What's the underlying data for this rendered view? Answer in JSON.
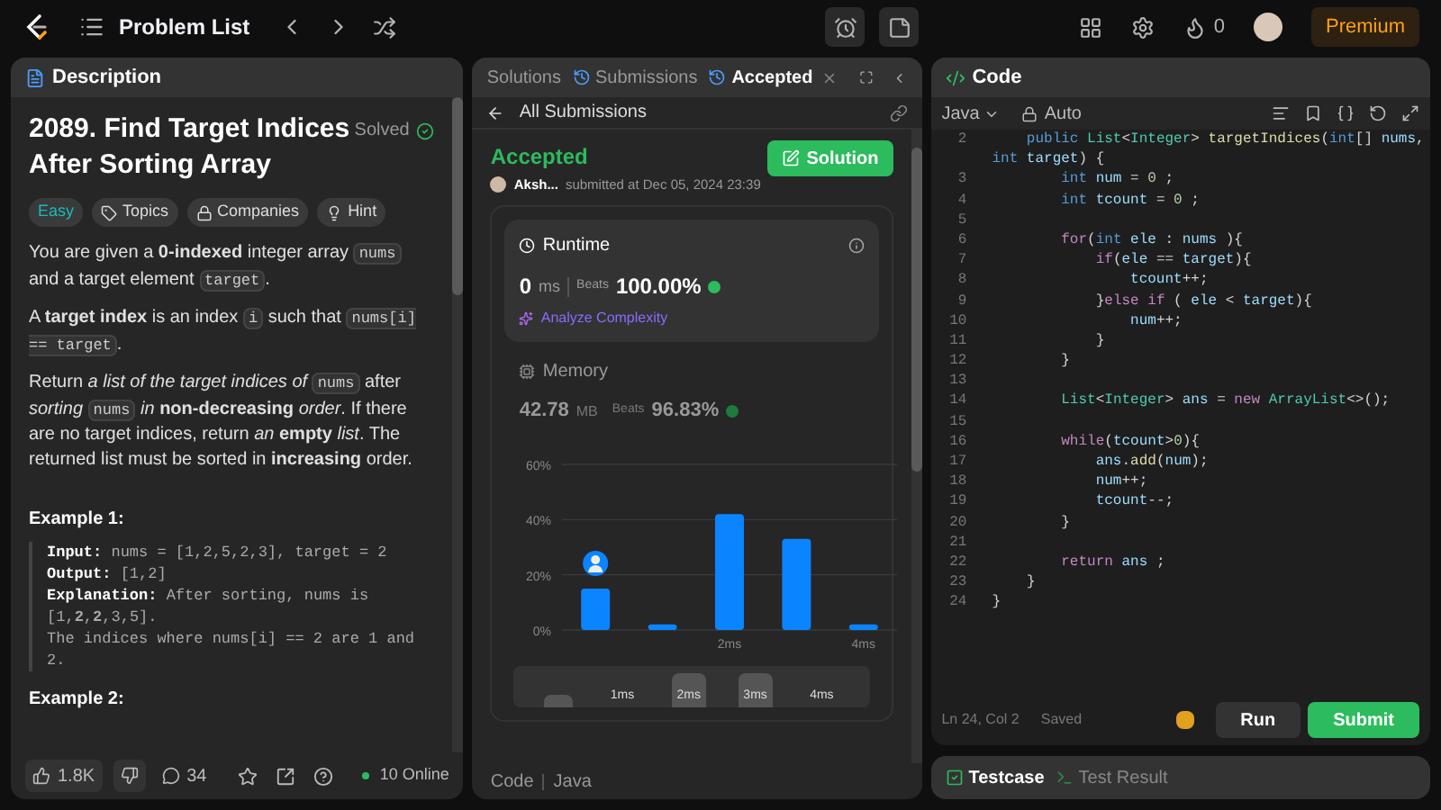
{
  "topbar": {
    "title": "Problem List",
    "streak": "0",
    "premium": "Premium"
  },
  "description": {
    "tab": "Description",
    "title": "2089. Find Target Indices After Sorting Array",
    "status": "Solved",
    "tags": [
      {
        "kind": "difficulty",
        "label": "Easy"
      },
      {
        "kind": "topics",
        "label": "Topics"
      },
      {
        "kind": "companies",
        "label": "Companies"
      },
      {
        "kind": "hint",
        "label": "Hint"
      }
    ],
    "paragraphs": [
      [
        {
          "kind": "text",
          "text": "You are given a **0-indexed** integer array "
        },
        {
          "kind": "code",
          "text": "nums"
        },
        {
          "kind": "text",
          "text": " and a target element "
        },
        {
          "kind": "code",
          "text": "target"
        },
        {
          "kind": "text",
          "text": "."
        }
      ],
      [
        {
          "kind": "text",
          "text": "A **target index** is an index "
        },
        {
          "kind": "code",
          "text": "i"
        },
        {
          "kind": "text",
          "text": " such that "
        },
        {
          "kind": "code",
          "text": "nums[i] == target"
        },
        {
          "kind": "text",
          "text": "."
        }
      ],
      [
        {
          "kind": "text",
          "text": "Return *a list of the target indices of* "
        },
        {
          "kind": "code",
          "text": "nums"
        },
        {
          "kind": "text",
          "text": " after *sorting* "
        },
        {
          "kind": "code",
          "text": "nums"
        },
        {
          "kind": "text",
          "text": " *in* **non-decreasing** *order*. If there are no target indices, return *an* **empty** *list*. The returned list must be sorted in **increasing** order."
        }
      ]
    ],
    "examples": [
      {
        "title": "Example 1:",
        "lines": [
          {
            "label": "Input:",
            "value": "nums = [1,2,5,2,3], target = 2"
          },
          {
            "label": "Output:",
            "value": "[1,2]"
          },
          {
            "label": "Explanation:",
            "value": "After sorting, nums is [1,**2**,**2**,3,5]."
          },
          {
            "value": "The indices where nums[i] == 2 are 1 and 2."
          }
        ]
      },
      {
        "title": "Example 2:"
      }
    ],
    "footer": {
      "likes": "1.8K",
      "comments": "34",
      "online": "10 Online"
    }
  },
  "submission": {
    "tabs": [
      {
        "label": "Solutions",
        "selected": false,
        "closable": false
      },
      {
        "label": "Submissions",
        "selected": false,
        "closable": false
      },
      {
        "label": "Accepted",
        "selected": true,
        "closable": true
      }
    ],
    "back": "All Submissions",
    "status": "Accepted",
    "user": "Aksh...",
    "submitted": "submitted at Dec 05, 2024 23:39",
    "solution": "Solution",
    "runtime": {
      "title": "Runtime",
      "value": "0",
      "unit": "ms",
      "beats_label": "Beats",
      "beats": "100.00%",
      "analyze": "Analyze Complexity"
    },
    "memory": {
      "title": "Memory",
      "value": "42.78",
      "unit": "MB",
      "beats_label": "Beats",
      "beats": "96.83%"
    },
    "chart_data": {
      "type": "bar",
      "x": [
        0,
        1,
        2,
        3,
        4
      ],
      "values": [
        15,
        2,
        42,
        33,
        2
      ],
      "xlim": [
        -0.5,
        4.5
      ],
      "ylim": [
        0,
        60
      ],
      "yticks": [
        {
          "value": 0,
          "label": "0%"
        },
        {
          "value": 20,
          "label": "20%"
        },
        {
          "value": 40,
          "label": "40%"
        },
        {
          "value": 60,
          "label": "60%"
        }
      ],
      "xticks": [
        {
          "value": 2,
          "label": "2ms"
        },
        {
          "value": 4,
          "label": "4ms"
        }
      ]
    },
    "navigator": [
      "1ms",
      "2ms",
      "3ms",
      "4ms"
    ],
    "footer": {
      "code": "Code",
      "language": "Java"
    }
  },
  "editor": {
    "tab": "Code",
    "language": "Java",
    "mode": "Auto",
    "lines": [
      {
        "number": "2",
        "tokens": [
          {
            "t": "    public ",
            "kind": "kw"
          },
          {
            "t": "List",
            "kind": "type"
          },
          {
            "t": "<",
            "kind": "plain"
          },
          {
            "t": "Integer",
            "kind": "type"
          },
          {
            "t": "> ",
            "kind": "plain"
          },
          {
            "t": "targetIndices",
            "kind": "fn"
          },
          {
            "t": "(",
            "kind": "plain"
          },
          {
            "t": "int",
            "kind": "kw"
          },
          {
            "t": "[] ",
            "kind": "plain"
          },
          {
            "t": "nums",
            "kind": "var"
          },
          {
            "t": ",",
            "kind": "plain"
          }
        ]
      },
      {
        "tokens": [
          {
            "t": "int ",
            "kind": "kw"
          },
          {
            "t": "target",
            "kind": "var"
          },
          {
            "t": ") {",
            "kind": "plain"
          }
        ]
      },
      {
        "number": "3",
        "tokens": [
          {
            "t": "        int ",
            "kind": "kw"
          },
          {
            "t": "num",
            "kind": "var"
          },
          {
            "t": " = ",
            "kind": "plain"
          },
          {
            "t": "0",
            "kind": "num"
          },
          {
            "t": " ;",
            "kind": "plain"
          }
        ]
      },
      {
        "number": "4",
        "tokens": [
          {
            "t": "        int ",
            "kind": "kw"
          },
          {
            "t": "tcount",
            "kind": "var"
          },
          {
            "t": " = ",
            "kind": "plain"
          },
          {
            "t": "0",
            "kind": "num"
          },
          {
            "t": " ;",
            "kind": "plain"
          }
        ]
      },
      {
        "number": "5"
      },
      {
        "number": "6",
        "tokens": [
          {
            "t": "        for",
            "kind": "ctrl"
          },
          {
            "t": "(",
            "kind": "plain"
          },
          {
            "t": "int ",
            "kind": "kw"
          },
          {
            "t": "ele",
            "kind": "var"
          },
          {
            "t": " : ",
            "kind": "plain"
          },
          {
            "t": "nums",
            "kind": "var"
          },
          {
            "t": " ){",
            "kind": "plain"
          }
        ]
      },
      {
        "number": "7",
        "tokens": [
          {
            "t": "            if",
            "kind": "ctrl"
          },
          {
            "t": "(",
            "kind": "plain"
          },
          {
            "t": "ele",
            "kind": "var"
          },
          {
            "t": " == ",
            "kind": "plain"
          },
          {
            "t": "target",
            "kind": "var"
          },
          {
            "t": "){",
            "kind": "plain"
          }
        ]
      },
      {
        "number": "8",
        "tokens": [
          {
            "t": "                tcount",
            "kind": "var"
          },
          {
            "t": "++;",
            "kind": "plain"
          }
        ]
      },
      {
        "number": "9",
        "tokens": [
          {
            "t": "            }",
            "kind": "plain"
          },
          {
            "t": "else if",
            "kind": "ctrl"
          },
          {
            "t": " ( ",
            "kind": "plain"
          },
          {
            "t": "ele",
            "kind": "var"
          },
          {
            "t": " < ",
            "kind": "plain"
          },
          {
            "t": "target",
            "kind": "var"
          },
          {
            "t": "){",
            "kind": "plain"
          }
        ]
      },
      {
        "number": "10",
        "tokens": [
          {
            "t": "                num",
            "kind": "var"
          },
          {
            "t": "++;",
            "kind": "plain"
          }
        ]
      },
      {
        "number": "11",
        "tokens": [
          {
            "t": "            }",
            "kind": "plain"
          }
        ]
      },
      {
        "number": "12",
        "tokens": [
          {
            "t": "        }",
            "kind": "plain"
          }
        ]
      },
      {
        "number": "13"
      },
      {
        "number": "14",
        "tokens": [
          {
            "t": "        List",
            "kind": "type"
          },
          {
            "t": "<",
            "kind": "plain"
          },
          {
            "t": "Integer",
            "kind": "type"
          },
          {
            "t": "> ",
            "kind": "plain"
          },
          {
            "t": "ans",
            "kind": "var"
          },
          {
            "t": " = ",
            "kind": "plain"
          },
          {
            "t": "new ",
            "kind": "ctrl"
          },
          {
            "t": "ArrayList",
            "kind": "type"
          },
          {
            "t": "<>();",
            "kind": "plain"
          }
        ]
      },
      {
        "number": "15"
      },
      {
        "number": "16",
        "tokens": [
          {
            "t": "        while",
            "kind": "ctrl"
          },
          {
            "t": "(",
            "kind": "plain"
          },
          {
            "t": "tcount",
            "kind": "var"
          },
          {
            "t": ">",
            "kind": "plain"
          },
          {
            "t": "0",
            "kind": "num"
          },
          {
            "t": "){",
            "kind": "plain"
          }
        ]
      },
      {
        "number": "17",
        "tokens": [
          {
            "t": "            ans",
            "kind": "var"
          },
          {
            "t": ".",
            "kind": "plain"
          },
          {
            "t": "add",
            "kind": "fn"
          },
          {
            "t": "(",
            "kind": "plain"
          },
          {
            "t": "num",
            "kind": "var"
          },
          {
            "t": ");",
            "kind": "plain"
          }
        ]
      },
      {
        "number": "18",
        "tokens": [
          {
            "t": "            num",
            "kind": "var"
          },
          {
            "t": "++;",
            "kind": "plain"
          }
        ]
      },
      {
        "number": "19",
        "tokens": [
          {
            "t": "            tcount",
            "kind": "var"
          },
          {
            "t": "--;",
            "kind": "plain"
          }
        ]
      },
      {
        "number": "20",
        "tokens": [
          {
            "t": "        }",
            "kind": "plain"
          }
        ]
      },
      {
        "number": "21"
      },
      {
        "number": "22",
        "tokens": [
          {
            "t": "        return ",
            "kind": "ctrl"
          },
          {
            "t": "ans",
            "kind": "var"
          },
          {
            "t": " ;",
            "kind": "plain"
          }
        ]
      },
      {
        "number": "23",
        "tokens": [
          {
            "t": "    }",
            "kind": "plain"
          }
        ]
      },
      {
        "number": "24",
        "tokens": [
          {
            "t": "}",
            "kind": "plain"
          }
        ]
      }
    ],
    "cursor": "Ln 24, Col 2",
    "saved": "Saved",
    "run": "Run",
    "submit": "Submit",
    "bottom_tabs": [
      {
        "kind": "testcase",
        "label": "Testcase",
        "selected": true
      },
      {
        "kind": "result",
        "label": "Test Result",
        "selected": false
      }
    ]
  }
}
